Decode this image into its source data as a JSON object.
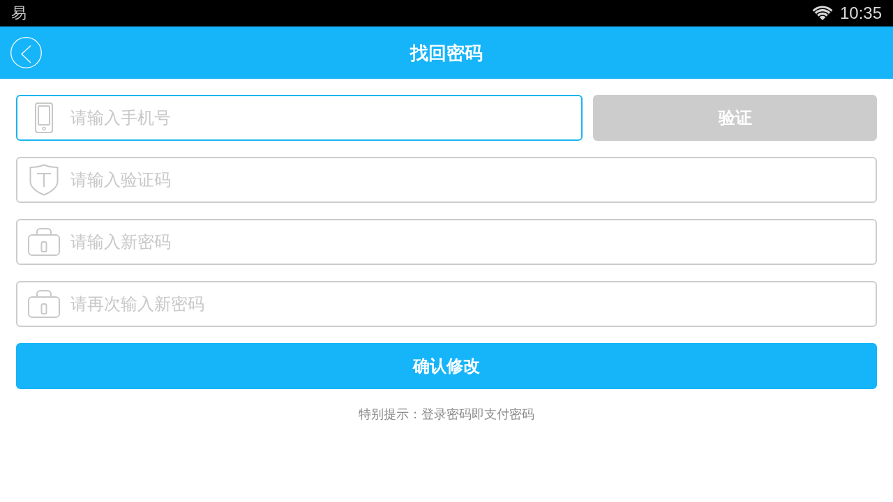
{
  "status_bar": {
    "notification": "易",
    "time": "10:35"
  },
  "header": {
    "title": "找回密码"
  },
  "fields": [
    {
      "kind": "phone",
      "placeholder": "请输入手机号",
      "focused": true
    },
    {
      "kind": "code",
      "placeholder": "请输入验证码",
      "focused": false
    },
    {
      "kind": "password",
      "placeholder": "请输入新密码",
      "focused": false
    },
    {
      "kind": "password",
      "placeholder": "请再次输入新密码",
      "focused": false
    }
  ],
  "verify_button": {
    "label": "验证",
    "disabled": true
  },
  "confirm_button": {
    "label": "确认修改"
  },
  "hint": "特别提示：登录密码即支付密码"
}
